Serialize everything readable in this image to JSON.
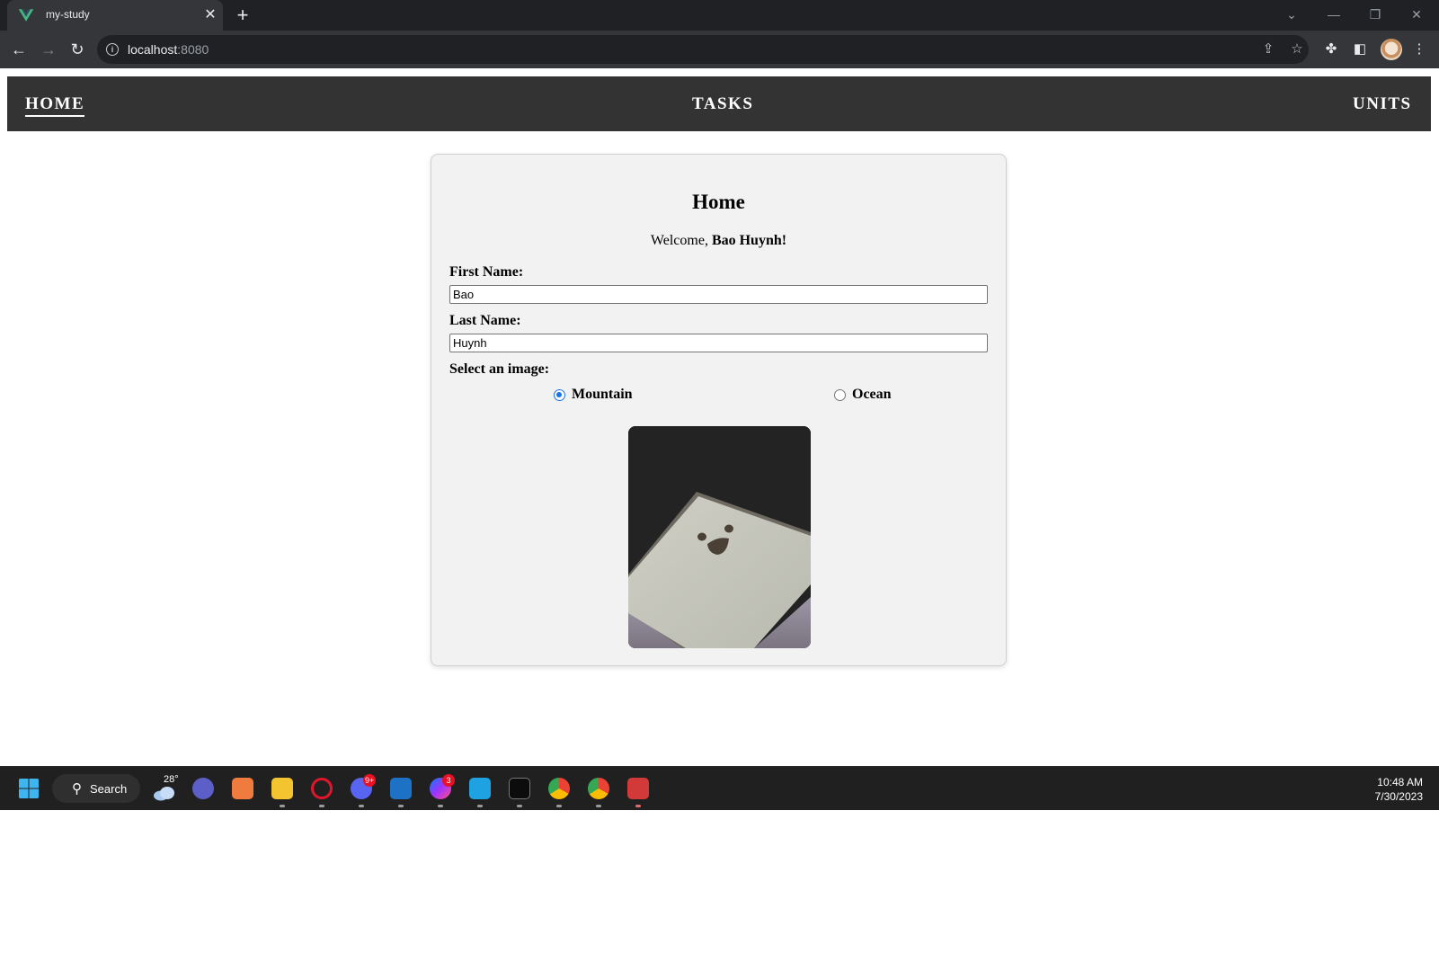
{
  "browser": {
    "tab_title": "my-study",
    "new_tab_symbol": "+",
    "url_host": "localhost",
    "url_port": ":8080"
  },
  "nav": {
    "links": [
      {
        "label": "HOME",
        "active": true
      },
      {
        "label": "TASKS",
        "active": false
      },
      {
        "label": "UNITS",
        "active": false
      }
    ]
  },
  "home": {
    "title": "Home",
    "welcome_prefix": "Welcome, ",
    "welcome_name": "Bao Huynh!",
    "first_name_label": "First Name:",
    "first_name_value": "Bao",
    "last_name_label": "Last Name:",
    "last_name_value": "Huynh",
    "image_select_label": "Select an image:",
    "image_options": [
      {
        "label": "Mountain",
        "checked": true
      },
      {
        "label": "Ocean",
        "checked": false
      }
    ]
  },
  "taskbar": {
    "search_label": "Search",
    "weather_temp": "28°",
    "time": "10:48 AM",
    "date": "7/30/2023",
    "discord_badge": "9+",
    "messenger_badge": "3"
  },
  "colors": {
    "nav_bg": "#333333",
    "card_bg": "#f2f2f2",
    "radio_accent": "#1a73e8"
  }
}
